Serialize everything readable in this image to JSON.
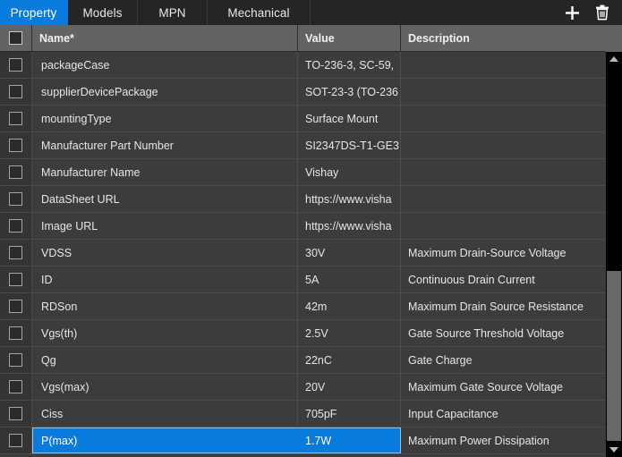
{
  "tabs": [
    {
      "label": "Property",
      "active": true
    },
    {
      "label": "Models",
      "active": false
    },
    {
      "label": "MPN",
      "active": false
    },
    {
      "label": "Mechanical",
      "active": false
    }
  ],
  "toolbar": {
    "add_label": "+",
    "add_icon": "plus-icon",
    "delete_icon": "trash-icon"
  },
  "table": {
    "columns": [
      "Name*",
      "Value",
      "Description"
    ],
    "header_checkbox_checked": false,
    "rows": [
      {
        "name": "packageCase",
        "value": "TO-236-3, SC-59,",
        "description": ""
      },
      {
        "name": "supplierDevicePackage",
        "value": "SOT-23-3 (TO-236",
        "description": ""
      },
      {
        "name": "mountingType",
        "value": "Surface Mount",
        "description": ""
      },
      {
        "name": "Manufacturer Part Number",
        "value": "SI2347DS-T1-GE3",
        "description": ""
      },
      {
        "name": "Manufacturer Name",
        "value": "Vishay",
        "description": ""
      },
      {
        "name": "DataSheet URL",
        "value": "https://www.visha",
        "description": ""
      },
      {
        "name": "Image URL",
        "value": "https://www.visha",
        "description": ""
      },
      {
        "name": "VDSS",
        "value": "30V",
        "description": "Maximum Drain-Source Voltage"
      },
      {
        "name": "ID",
        "value": "5A",
        "description": "Continuous Drain Current"
      },
      {
        "name": "RDSon",
        "value": "42m",
        "description": "Maximum Drain Source Resistance"
      },
      {
        "name": "Vgs(th)",
        "value": "2.5V",
        "description": "Gate Source Threshold Voltage"
      },
      {
        "name": "Qg",
        "value": "22nC",
        "description": "Gate Charge"
      },
      {
        "name": "Vgs(max)",
        "value": "20V",
        "description": "Maximum Gate Source Voltage"
      },
      {
        "name": "Ciss",
        "value": "705pF",
        "description": "Input Capacitance"
      },
      {
        "name": "P(max)",
        "value": "1.7W",
        "description": "Maximum Power Dissipation",
        "selected": true
      }
    ]
  },
  "scrollbar": {
    "up_icon": "chevron-up-icon",
    "down_icon": "chevron-down-icon",
    "thumb_name": "scrollbar-thumb"
  },
  "colors": {
    "accent": "#0a7bdb",
    "selection_border": "#8fc6f0",
    "tabbar_bg": "#252525",
    "header_bg": "#636363",
    "row_bg": "#3c3c3c",
    "checkbox_col_bg": "#343434",
    "scrollbar_track": "#000000",
    "scrollbar_thumb": "#686868"
  }
}
